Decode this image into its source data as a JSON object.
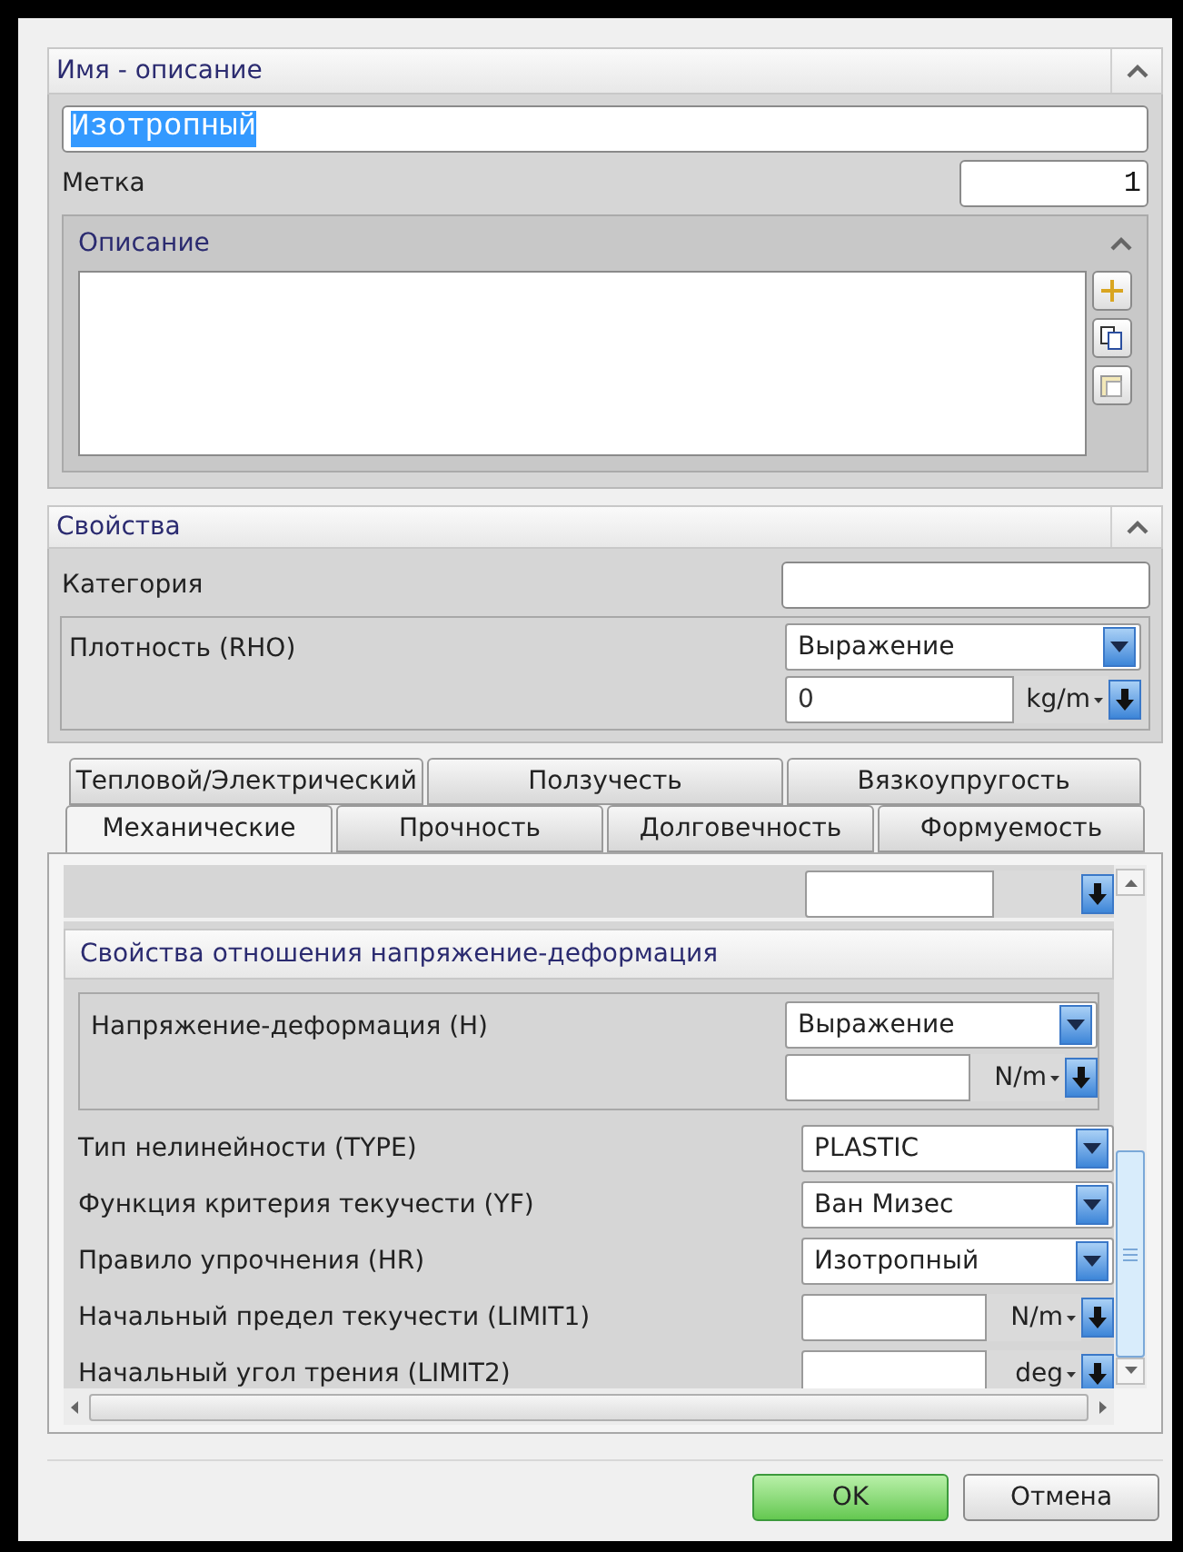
{
  "name_section": {
    "title": "Имя - описание",
    "expanded": true,
    "name_value": "Изотропный",
    "label": "Метка",
    "label_value": "1",
    "description": {
      "title": "Описание",
      "expanded": true
    }
  },
  "properties": {
    "title": "Свойства",
    "expanded": true,
    "category_label": "Категория",
    "density": {
      "label": "Плотность (RHO)",
      "mode": "Выражение",
      "value": "0",
      "unit": "kg/m"
    }
  },
  "tab_rows": [
    {
      "tabs": [
        {
          "label": "Тепловой/Электрический",
          "selected": false
        },
        {
          "label": "Ползучесть",
          "selected": false
        },
        {
          "label": "Вязкоупругость",
          "selected": false
        }
      ]
    },
    {
      "tabs": [
        {
          "label": "Механические",
          "selected": true
        },
        {
          "label": "Прочность",
          "selected": false
        },
        {
          "label": "Долговечность",
          "selected": false
        },
        {
          "label": "Формуемость",
          "selected": false
        }
      ]
    }
  ],
  "stress_strain": {
    "title": "Свойства отношения напряжение-деформация",
    "h": {
      "label": "Напряжение-деформация (H)",
      "mode": "Выражение",
      "unit": "N/m"
    },
    "rows": [
      {
        "kind": "select",
        "label": "Тип нелинейности (TYPE)",
        "value": "PLASTIC"
      },
      {
        "kind": "select",
        "label": "Функция критерия текучести (YF)",
        "value": "Ван Мизес"
      },
      {
        "kind": "select",
        "label": "Правило упрочнения (HR)",
        "value": "Изотропный"
      },
      {
        "kind": "unit",
        "label": "Начальный предел текучести (LIMIT1)",
        "unit": "N/m"
      },
      {
        "kind": "unit",
        "label": "Начальный угол трения (LIMIT2)",
        "unit": "deg"
      }
    ]
  },
  "buttons": [
    {
      "label": "OK",
      "kind": "primary"
    },
    {
      "label": "Отмена",
      "kind": "secondary"
    }
  ]
}
